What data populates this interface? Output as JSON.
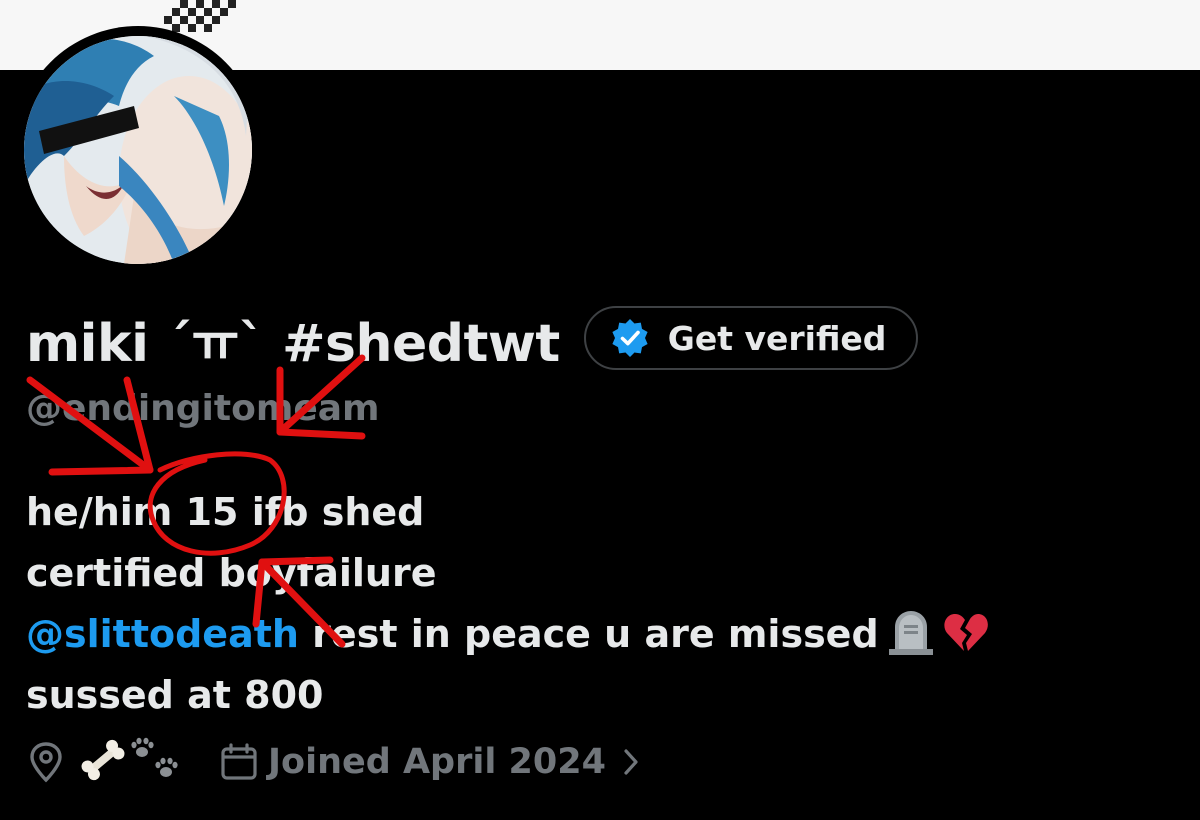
{
  "profile": {
    "display_name": "miki ´ㅠ` #shedtwt",
    "verify_label": "Get verified",
    "handle": "@endingitomeam",
    "bio_line1": "he/him 15 ifb shed",
    "bio_line2": "certified boyfailure",
    "bio_mention": "@slittodeath",
    "bio_line3_rest": " rest in peace u are missed",
    "bio_line4": "sussed at 800",
    "joined": "Joined April 2024"
  },
  "icons": {
    "verify": "verified-badge-icon",
    "location": "location-pin-icon",
    "bone": "bone-emoji",
    "paws": "paw-prints-emoji",
    "calendar": "calendar-icon",
    "chevron": "chevron-right-icon",
    "headstone": "headstone-emoji",
    "broken_heart": "broken-heart-emoji"
  },
  "colors": {
    "background": "#000000",
    "text": "#e7e9ea",
    "secondary": "#71767b",
    "accent": "#1d9bf0",
    "annotation": "#e01010"
  }
}
